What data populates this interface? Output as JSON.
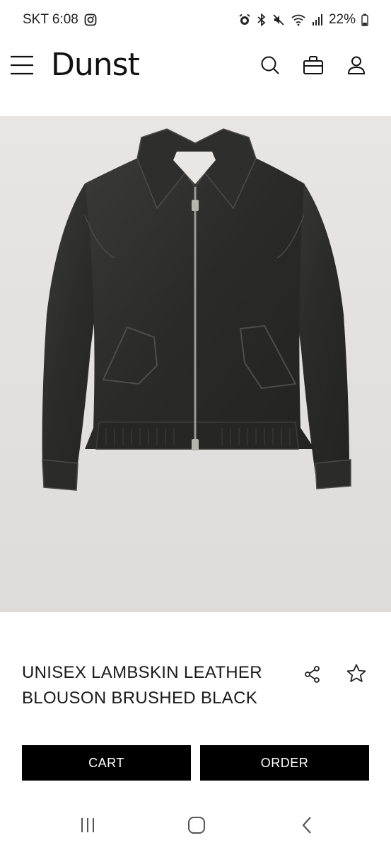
{
  "status_bar": {
    "carrier_time": "SKT 6:08",
    "battery": "22%",
    "icons": [
      "instagram-icon",
      "alarm-icon",
      "bluetooth-icon",
      "mute-icon",
      "wifi-icon",
      "signal-icon",
      "battery-icon"
    ]
  },
  "header": {
    "brand": "Dunst",
    "icons": [
      "menu-icon",
      "search-icon",
      "bag-icon",
      "account-icon"
    ]
  },
  "product": {
    "title_line1": "UNISEX LAMBSKIN LEATHER",
    "title_line2": "BLOUSON BRUSHED BLACK",
    "icons": [
      "share-icon",
      "star-icon"
    ]
  },
  "actions": {
    "cart_label": "CART",
    "order_label": "ORDER"
  },
  "nav_bar": {
    "icons": [
      "recent-apps-icon",
      "home-icon",
      "back-icon"
    ]
  },
  "colors": {
    "button_bg": "#000000",
    "image_bg": "#e5e3e1",
    "text": "#1a1a1a"
  }
}
